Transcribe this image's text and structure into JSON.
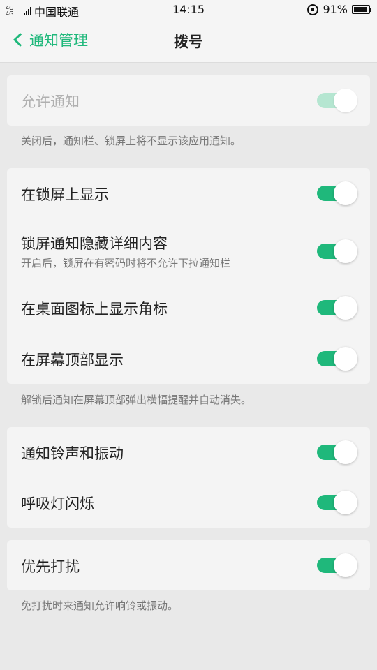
{
  "status_bar": {
    "network": "4G 4G",
    "carrier": "中国联通",
    "time": "14:15",
    "battery": "91%",
    "battery_level": 0.91
  },
  "header": {
    "back_label": "通知管理",
    "title": "拨号"
  },
  "section1": {
    "allow_label": "允许通知",
    "allow_on": true,
    "allow_disabled": true,
    "footnote": "关闭后，通知栏、锁屏上将不显示该应用通知。"
  },
  "section2": {
    "rows": [
      {
        "label": "在锁屏上显示",
        "sub": "",
        "on": true
      },
      {
        "label": "锁屏通知隐藏详细内容",
        "sub": "开启后，锁屏在有密码时将不允许下拉通知栏",
        "on": true
      },
      {
        "label": "在桌面图标上显示角标",
        "sub": "",
        "on": true
      },
      {
        "label": "在屏幕顶部显示",
        "sub": "",
        "on": true
      }
    ],
    "footnote": "解锁后通知在屏幕顶部弹出横幅提醒并自动消失。"
  },
  "section3": {
    "rows": [
      {
        "label": "通知铃声和振动",
        "on": true
      },
      {
        "label": "呼吸灯闪烁",
        "on": true
      }
    ]
  },
  "section4": {
    "rows": [
      {
        "label": "优先打扰",
        "on": true
      }
    ],
    "footnote": "免打扰时来通知允许响铃或振动。"
  },
  "colors": {
    "accent": "#1fb87b",
    "accent_disabled": "#b5e6d1",
    "background": "#e9e9e9",
    "card": "#f4f4f4"
  }
}
